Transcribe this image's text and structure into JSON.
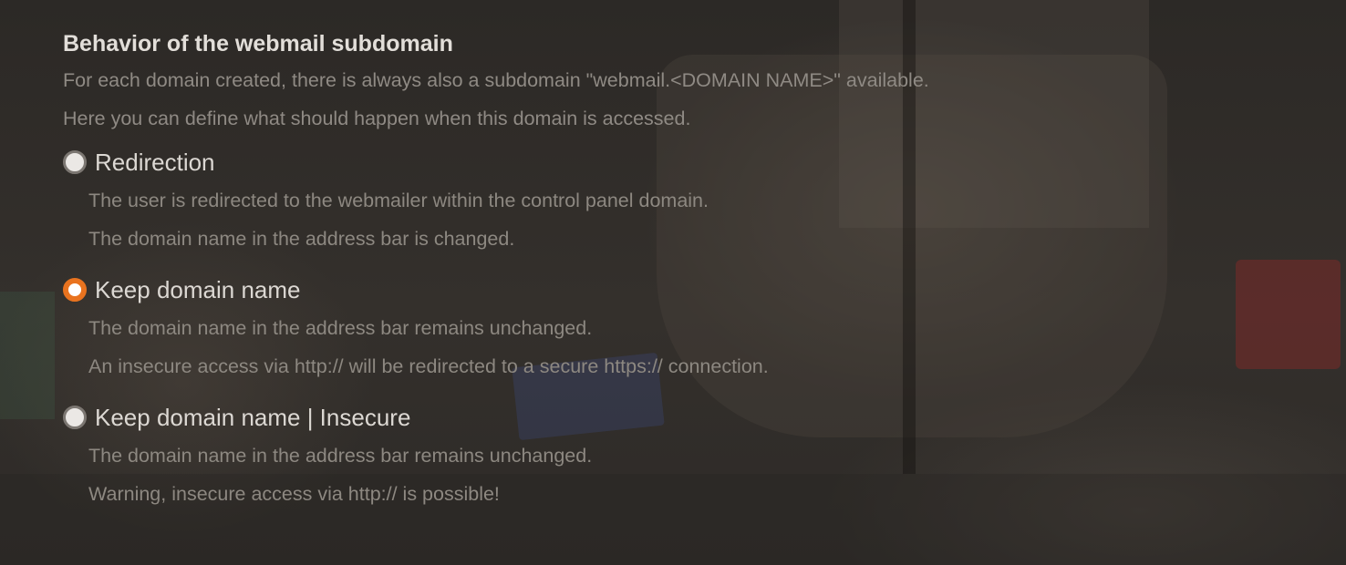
{
  "section": {
    "title": "Behavior of the webmail subdomain",
    "description": [
      "For each domain created, there is always also a subdomain \"webmail.<DOMAIN NAME>\" available.",
      "Here you can define what should happen when this domain is accessed."
    ]
  },
  "options": [
    {
      "label": "Redirection",
      "selected": false,
      "description": [
        "The user is redirected to the webmailer within the control panel domain.",
        "The domain name in the address bar is changed."
      ]
    },
    {
      "label": "Keep domain name",
      "selected": true,
      "description": [
        "The domain name in the address bar remains unchanged.",
        "An insecure access via http:// will be redirected to a secure https:// connection."
      ]
    },
    {
      "label": "Keep domain name | Insecure",
      "selected": false,
      "description": [
        "The domain name in the address bar remains unchanged.",
        "Warning, insecure access via http:// is possible!"
      ]
    }
  ],
  "colors": {
    "accent": "#e9731f",
    "radio_unselected_fill": "#ebe8e5",
    "title_text": "#e2ded9",
    "description_text": "#8f8a84"
  }
}
